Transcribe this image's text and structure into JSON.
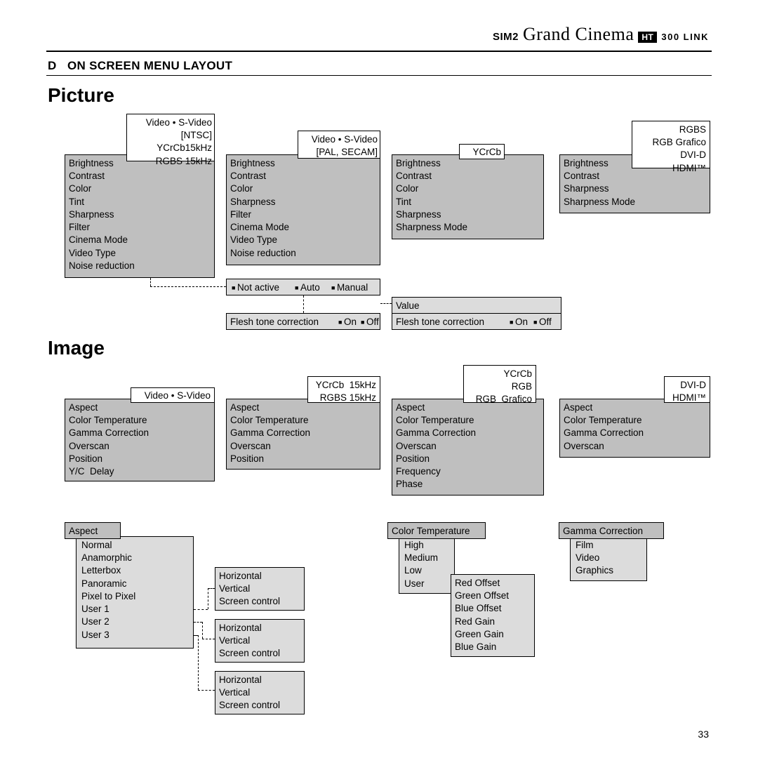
{
  "brand": {
    "sim2": "SIM2",
    "cursive": "Grand Cinema",
    "ht": "HT",
    "model": "300 LINK"
  },
  "section": {
    "letter": "D",
    "title": "ON SCREEN MENU LAYOUT"
  },
  "headings": {
    "picture": "Picture",
    "image": "Image"
  },
  "picture": {
    "label1": "Video • S-Video\n[NTSC]\nYCrCb15kHz\nRGBS 15kHz",
    "menu1": "Brightness\nContrast\nColor\nTint\nSharpness\nFilter\nCinema Mode\nVideo Type\nNoise reduction",
    "label2": "Video • S-Video\n[PAL, SECAM]",
    "menu2": "Brightness\nContrast\nColor\nSharpness\nFilter\nCinema Mode\nVideo Type\nNoise reduction",
    "label3": "YCrCb",
    "menu3": "Brightness\nContrast\nColor\nTint\nSharpness\nSharpness Mode",
    "label4": "RGBS\nRGB Grafico\nDVI-D\nHDMI™",
    "menu4": "Brightness\nContrast\nSharpness\nSharpness Mode",
    "noiseOpts": {
      "b1": "Not active",
      "b2": "Auto",
      "b3": "Manual"
    },
    "ftc1": {
      "label": "Flesh tone correction",
      "on": "On",
      "off": "Off"
    },
    "valueLabel": "Value",
    "ftc2": {
      "label": "Flesh tone correction",
      "on": "On",
      "off": "Off"
    }
  },
  "image": {
    "label1": "Video • S-Video",
    "menu1": "Aspect\nColor Temperature\nGamma Correction\nOverscan\nPosition\nY/C  Delay",
    "label2": "YCrCb  15kHz\nRGBS 15kHz",
    "menu2": "Aspect\nColor Temperature\nGamma Correction\nOverscan\nPosition",
    "label3": "YCrCb\nRGB\nRGB  Grafico",
    "menu3": "Aspect\nColor Temperature\nGamma Correction\nOverscan\nPosition\nFrequency\nPhase",
    "label4": "DVI-D\nHDMI™",
    "menu4": "Aspect\nColor Temperature\nGamma Correction\nOverscan"
  },
  "aspect": {
    "title": "Aspect",
    "opts": "Normal\nAnamorphic\nLetterbox\nPanoramic\nPixel to Pixel\nUser 1\nUser 2\nUser 3"
  },
  "posA": "Horizontal\nVertical\nScreen control",
  "posB": "Horizontal\nVertical\nScreen control",
  "posC": "Horizontal\nVertical\nScreen control",
  "colortemp": {
    "title": "Color Temperature",
    "opts": "High\nMedium\nLow\nUser"
  },
  "userCT": "Red Offset\nGreen Offset\nBlue Offset\nRed Gain\nGreen Gain\nBlue Gain",
  "gamma": {
    "title": "Gamma Correction",
    "opts": "Film\nVideo\nGraphics"
  },
  "pageNumber": "33"
}
